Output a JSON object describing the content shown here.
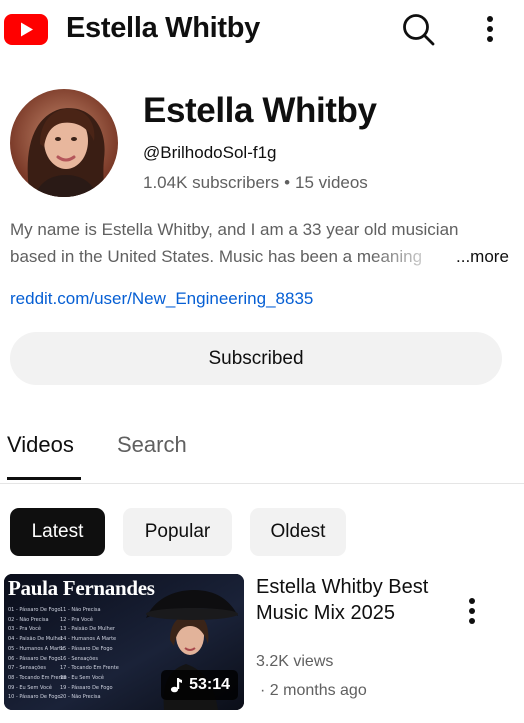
{
  "header": {
    "logo_icon": "youtube-logo-icon",
    "title": "Estella Whitby",
    "search_icon": "search-icon",
    "more_icon": "more-vertical-icon"
  },
  "channel": {
    "name": "Estella Whitby",
    "handle": "@BrilhodoSol-f1g",
    "subscribers": "1.04K subscribers",
    "separator": "•",
    "videos": "15 videos",
    "description_line1": "My name is Estella Whitby, and I am a 33 year old musician",
    "description_line2": "based in the United States. Music has been a meaning",
    "more_label": "...more",
    "link": "reddit.com/user/New_Engineering_8835",
    "subscribe_label": "Subscribed"
  },
  "tabs": [
    {
      "label": "Videos",
      "active": true
    },
    {
      "label": "Search",
      "active": false
    }
  ],
  "chips": [
    {
      "label": "Latest",
      "active": true
    },
    {
      "label": "Popular",
      "active": false
    },
    {
      "label": "Oldest",
      "active": false
    }
  ],
  "videos": [
    {
      "thumbnail_title": "Paula Fernandes",
      "tracklist_left": [
        "01 - Pássaro De Fogo",
        "02 - Não Precisa",
        "03 - Pra Você",
        "04 - Paixão De Mulher",
        "05 - Humanos A Marte",
        "06 - Pássaro De Fogo",
        "07 - Sensações",
        "08 - Tocando Em Frente",
        "09 - Eu Sem Você",
        "10 - Pássaro De Fogo"
      ],
      "tracklist_right": [
        "11 - Não Precisa",
        "12 - Pra Você",
        "13 - Paixão De Mulher",
        "14 - Humanos A Marte",
        "15 - Pássaro De Fogo",
        "16 - Sensações",
        "17 - Tocando Em Frente",
        "18 - Eu Sem Você",
        "19 - Pássaro De Fogo",
        "20 - Não Precisa"
      ],
      "duration": "53:14",
      "duration_icon": "music-note-icon",
      "title": "Estella Whitby Best Music Mix 2025",
      "views": "3.2K views",
      "age": "· 2 months ago",
      "more_icon": "more-vertical-icon"
    }
  ],
  "colors": {
    "brand_red": "#ff0000",
    "link_blue": "#065fd4",
    "secondary_text": "#606060",
    "chip_bg": "#f2f2f2",
    "active_chip_bg": "#0f0f0f"
  }
}
